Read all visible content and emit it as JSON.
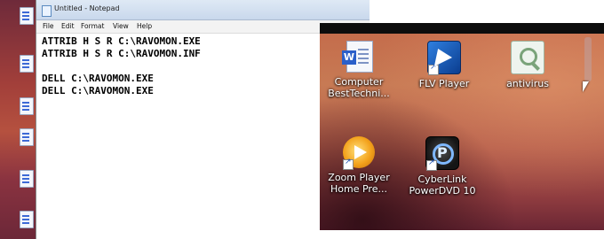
{
  "notepad": {
    "title": "Untitled - Notepad",
    "menu": [
      "File",
      "Edit",
      "Format",
      "View",
      "Help"
    ],
    "lines": [
      "ATTRIB H S R C:\\RAVOMON.EXE",
      "ATTRIB H S R C:\\RAVOMON.INF",
      "",
      "DELL C:\\RAVOMON.EXE",
      "DELL C:\\RAVOMON.EXE"
    ]
  },
  "desktop": {
    "icons": [
      {
        "label": "Computer BestTechni...",
        "icon": "word-document-icon"
      },
      {
        "label": "FLV Player",
        "icon": "flv-player-icon"
      },
      {
        "label": "antivirus",
        "icon": "antivirus-icon"
      },
      {
        "label": "Zoom Player Home Pre...",
        "icon": "zoom-player-icon"
      },
      {
        "label": "CyberLink PowerDVD 10",
        "icon": "powerdvd-icon"
      }
    ]
  }
}
